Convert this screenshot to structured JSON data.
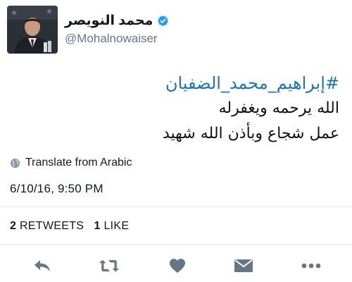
{
  "user": {
    "display_name": "محمد النويصر",
    "handle": "@Mohalnowaiser",
    "verified": true
  },
  "tweet": {
    "hashtag": "#إبراهيم_محمد_الضفيان",
    "lines": [
      "الله يرحمه ويغفرله",
      "عمل شجاع وبأذن الله شهيد"
    ]
  },
  "translate": {
    "label": "Translate from Arabic",
    "icon": "globe-icon"
  },
  "timestamp": "6/10/16, 9:50 PM",
  "stats": {
    "retweets_count": "2",
    "retweets_label": "RETWEETS",
    "likes_count": "1",
    "likes_label": "LIKE"
  },
  "actions": [
    {
      "name": "reply",
      "icon": "reply-icon"
    },
    {
      "name": "retweet",
      "icon": "retweet-icon"
    },
    {
      "name": "like",
      "icon": "heart-icon"
    },
    {
      "name": "direct-message",
      "icon": "envelope-icon"
    },
    {
      "name": "more",
      "icon": "more-icon"
    }
  ],
  "colors": {
    "hashtag": "#1b74b8",
    "verified": "#1da1f2",
    "icons": "#657786",
    "divider": "#e1e8ed"
  }
}
